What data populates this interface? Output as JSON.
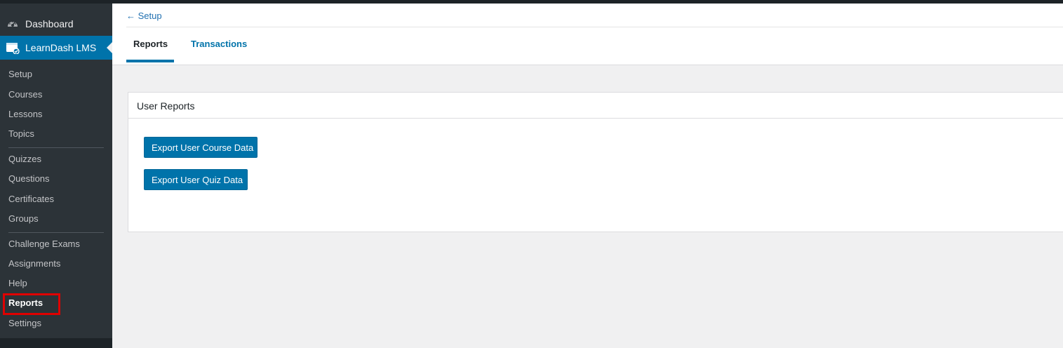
{
  "colors": {
    "accent": "#0073aa",
    "sidebar_bg": "#2c3338",
    "highlight": "#e00000"
  },
  "sidebar": {
    "dashboard": {
      "label": "Dashboard",
      "icon": "dashboard-gauge-icon"
    },
    "learndash": {
      "label": "LearnDash LMS",
      "icon": "learndash-icon"
    },
    "items": [
      {
        "label": "Setup"
      },
      {
        "label": "Courses"
      },
      {
        "label": "Lessons"
      },
      {
        "label": "Topics"
      },
      {
        "label": "Quizzes"
      },
      {
        "label": "Questions"
      },
      {
        "label": "Certificates"
      },
      {
        "label": "Groups"
      },
      {
        "label": "Challenge Exams"
      },
      {
        "label": "Assignments"
      },
      {
        "label": "Help"
      },
      {
        "label": "Reports",
        "current": true
      },
      {
        "label": "Settings"
      }
    ]
  },
  "header": {
    "breadcrumb": "← Setup",
    "tabs": [
      {
        "label": "Reports",
        "active": true
      },
      {
        "label": "Transactions",
        "active": false
      }
    ]
  },
  "panel": {
    "title": "User Reports",
    "buttons": [
      {
        "label": "Export User Course Data"
      },
      {
        "label": "Export User Quiz Data"
      }
    ]
  }
}
